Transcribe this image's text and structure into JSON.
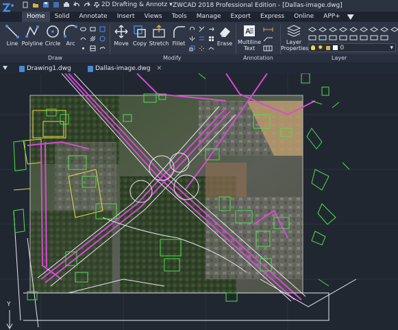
{
  "app": {
    "title": "ZWCAD 2018 Professional Edition - [Dallas-image.dwg]",
    "workspace": "2D Drafting & Annotz",
    "accent": "#3b6fb6"
  },
  "tabs": [
    {
      "label": "Home",
      "active": true
    },
    {
      "label": "Solid"
    },
    {
      "label": "Annotate"
    },
    {
      "label": "Insert"
    },
    {
      "label": "Views"
    },
    {
      "label": "Tools"
    },
    {
      "label": "Manage"
    },
    {
      "label": "Export"
    },
    {
      "label": "Express"
    },
    {
      "label": "Online"
    },
    {
      "label": "APP+"
    }
  ],
  "ribbon": {
    "draw": {
      "title": "Draw",
      "line": "Line",
      "polyline": "Polyline",
      "circle": "Circle",
      "arc": "Arc"
    },
    "modify": {
      "title": "Modify",
      "move": "Move",
      "copy": "Copy",
      "stretch": "Stretch",
      "fillet": "Fillet",
      "erase": "Erase"
    },
    "annotation": {
      "title": "Annotation",
      "mtext_line1": "Multiline",
      "mtext_line2": "Text"
    },
    "layer": {
      "title": "Layer",
      "props_line1": "Layer",
      "props_line2": "Properties",
      "current_layer": "0"
    }
  },
  "documents": [
    {
      "name": "Drawing1.dwg",
      "active": false
    },
    {
      "name": "Dallas-image.dwg",
      "active": true
    }
  ],
  "ucs": {
    "y_label": "Y"
  },
  "colors": {
    "road_magenta": "#d64bd6",
    "road_white": "#e8e8f0",
    "building_green": "#4ee04e",
    "yellow_lines": "#e8e040"
  }
}
